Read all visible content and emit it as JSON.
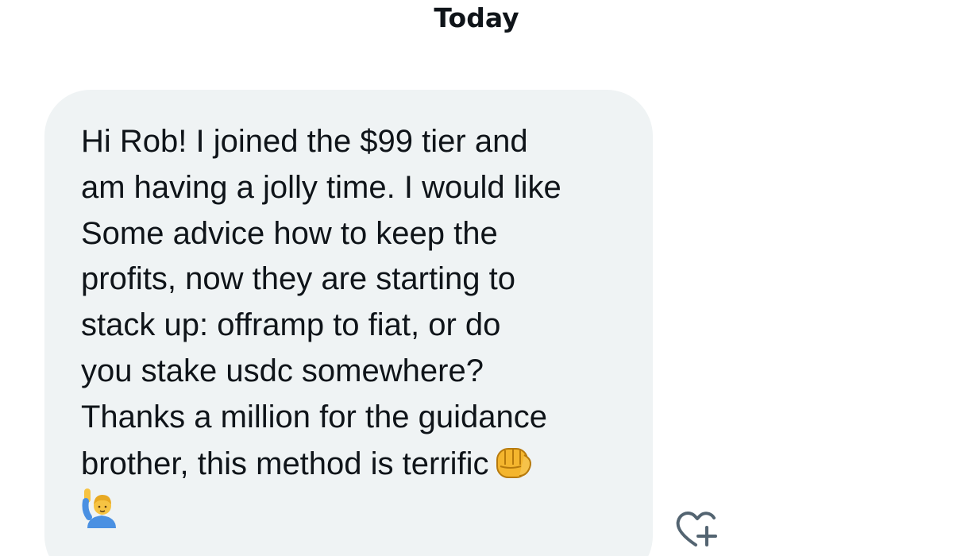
{
  "conversation": {
    "date_separator": "Today"
  },
  "message": {
    "lines": [
      "Hi Rob! I joined the $99 tier and",
      "am having a jolly time. I would like",
      "Some advice how to keep the",
      "profits, now they are starting to",
      "stack up: offramp to fiat, or do",
      "you stake usdc somewhere?",
      "Thanks a million for the guidance",
      "brother, this method is terrific"
    ],
    "trailing_emojis": [
      "oncoming-fist-emoji",
      "person-raising-hand-emoji"
    ]
  },
  "actions": {
    "react_icon": "heart-plus-icon"
  },
  "colors": {
    "bubble_background": "#eff3f4",
    "text": "#0f1419",
    "icon": "#536471"
  }
}
